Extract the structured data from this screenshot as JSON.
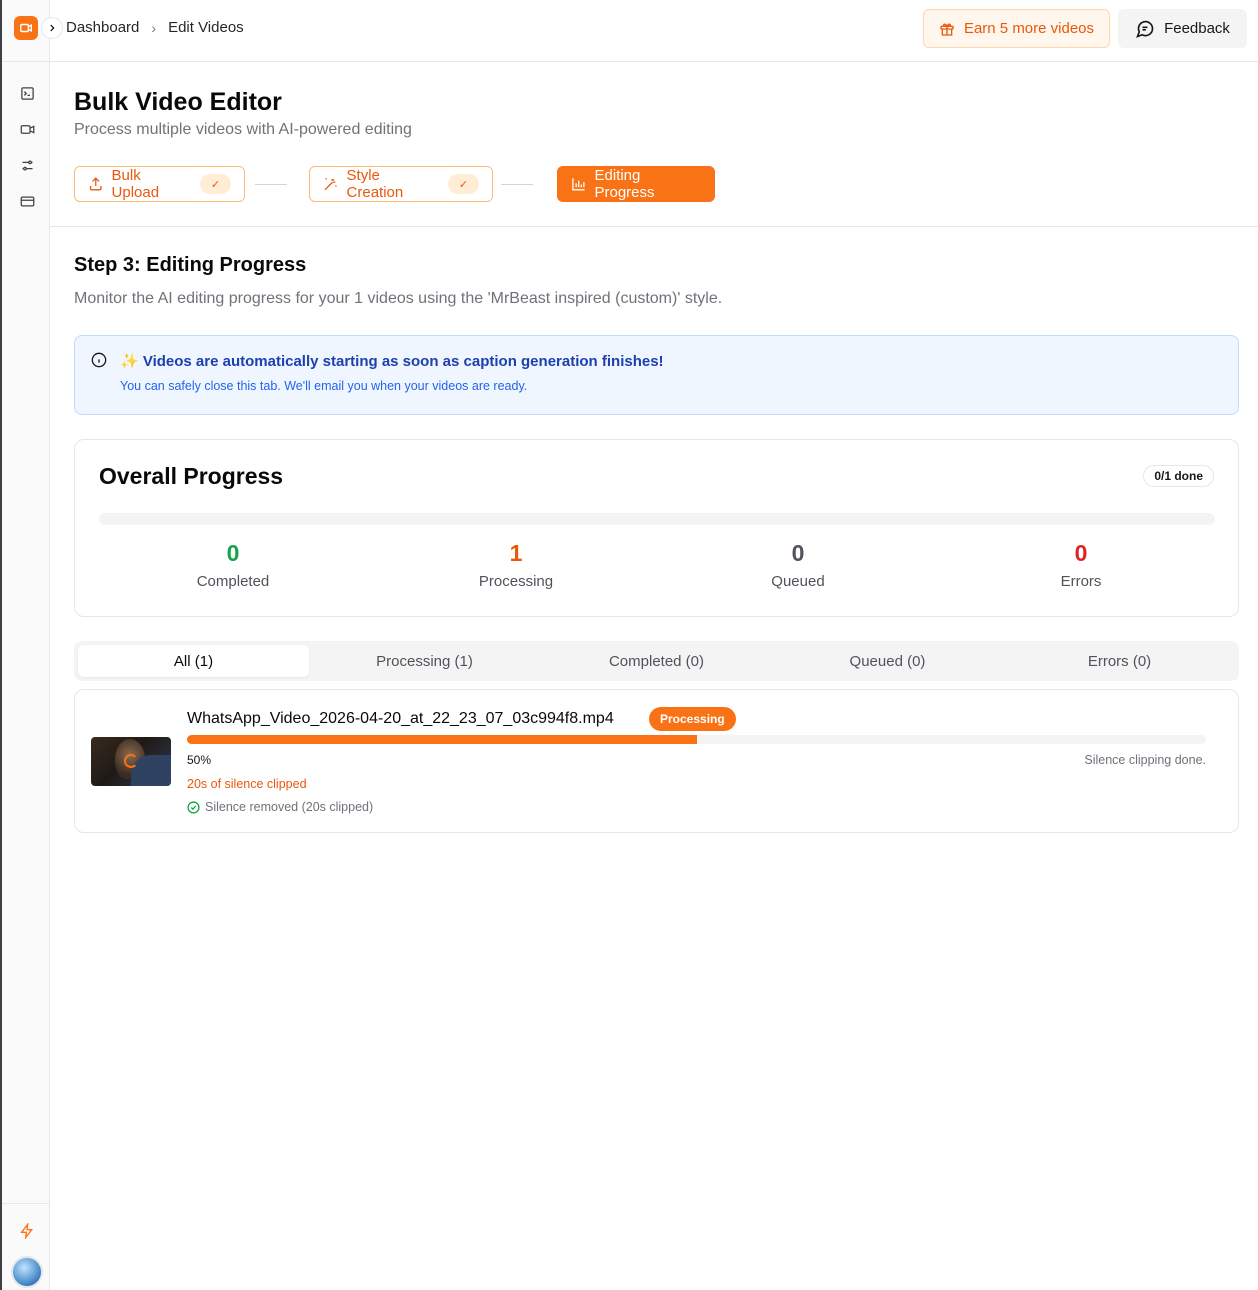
{
  "breadcrumb": {
    "root": "Dashboard",
    "current": "Edit Videos"
  },
  "topbar": {
    "earn_label": "Earn 5 more videos",
    "feedback_label": "Feedback"
  },
  "header": {
    "title": "Bulk Video Editor",
    "subtitle": "Process multiple videos with AI-powered editing",
    "steps": [
      {
        "label": "Bulk Upload",
        "state": "done",
        "check": "✓"
      },
      {
        "label": "Style Creation",
        "state": "done",
        "check": "✓"
      },
      {
        "label": "Editing Progress",
        "state": "active"
      }
    ]
  },
  "step": {
    "heading": "Step 3: Editing Progress",
    "description": "Monitor the AI editing progress for your 1 videos using the 'MrBeast inspired (custom)' style."
  },
  "info": {
    "title": "✨ Videos are automatically starting as soon as caption generation finishes!",
    "subtitle": "You can safely close this tab. We'll email you when your videos are ready."
  },
  "overall": {
    "title": "Overall Progress",
    "badge": "0/1 done",
    "progress": 0,
    "stats": [
      {
        "value": "0",
        "label": "Completed",
        "color": "#16a34a"
      },
      {
        "value": "1",
        "label": "Processing",
        "color": "#ea580c"
      },
      {
        "value": "0",
        "label": "Queued",
        "color": "#52525b"
      },
      {
        "value": "0",
        "label": "Errors",
        "color": "#dc2626"
      }
    ]
  },
  "tabs": [
    {
      "label": "All (1)",
      "active": true
    },
    {
      "label": "Processing (1)"
    },
    {
      "label": "Completed (0)"
    },
    {
      "label": "Queued (0)"
    },
    {
      "label": "Errors (0)"
    }
  ],
  "videos": [
    {
      "name": "WhatsApp_Video_2026-04-20_at_22_23_07_03c994f8.mp4",
      "status_badge": "Processing",
      "progress": 0.5,
      "percent_label": "50%",
      "status_text": "Silence clipping done.",
      "silence_text": "20s of silence clipped",
      "removed_text": "Silence removed (20s clipped)"
    }
  ],
  "colors": {
    "accent": "#f97316",
    "accent_dark": "#ea580c",
    "info_bg": "#eff6ff",
    "info_text": "#1e40af"
  }
}
